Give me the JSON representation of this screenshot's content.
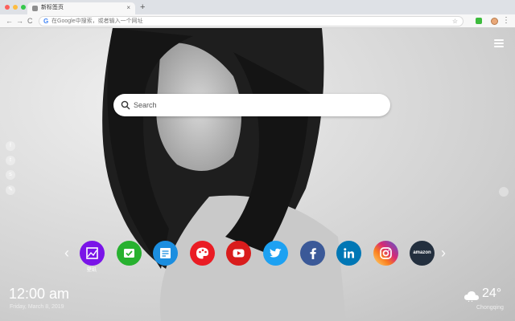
{
  "browser": {
    "tab_title": "新标签页",
    "tab_close": "×",
    "new_tab": "+",
    "back": "←",
    "forward": "→",
    "reload": "C",
    "omnibox_placeholder": "在Google中搜索，或者输入一个网址",
    "g_logo": "G",
    "bookmark_star": "☆",
    "kebab": "⋮",
    "dot_colors": [
      "#fc605c",
      "#fdbc40",
      "#34c84a"
    ]
  },
  "search": {
    "placeholder": "Search"
  },
  "social_links": [
    {
      "name": "facebook-icon",
      "glyph": "f"
    },
    {
      "name": "twitter-icon",
      "glyph": "t"
    },
    {
      "name": "share-icon",
      "glyph": "s"
    },
    {
      "name": "link-icon",
      "glyph": "✎"
    }
  ],
  "nav": {
    "prev": "‹",
    "next": "›"
  },
  "apps": [
    {
      "name": "wallpaper-app",
      "color": "#7a14e8",
      "label": "壁纸"
    },
    {
      "name": "todo-app",
      "color": "#27b12f"
    },
    {
      "name": "notes-app",
      "color": "#1b8ee0"
    },
    {
      "name": "paint-app",
      "color": "#ea1c24"
    },
    {
      "name": "youtube-app",
      "color": "#d91c1c"
    },
    {
      "name": "twitter-app",
      "color": "#1da1f2"
    },
    {
      "name": "facebook-app",
      "color": "#3b5998"
    },
    {
      "name": "linkedin-app",
      "color": "#0077b5"
    },
    {
      "name": "instagram-app",
      "color": "#d62976"
    },
    {
      "name": "amazon-app",
      "color": "#232f3e",
      "text": "amazon"
    }
  ],
  "clock": {
    "time": "12:00 am",
    "date": "Friday, March 8, 2019"
  },
  "weather": {
    "temp": "24°",
    "city": "Chongqing"
  }
}
